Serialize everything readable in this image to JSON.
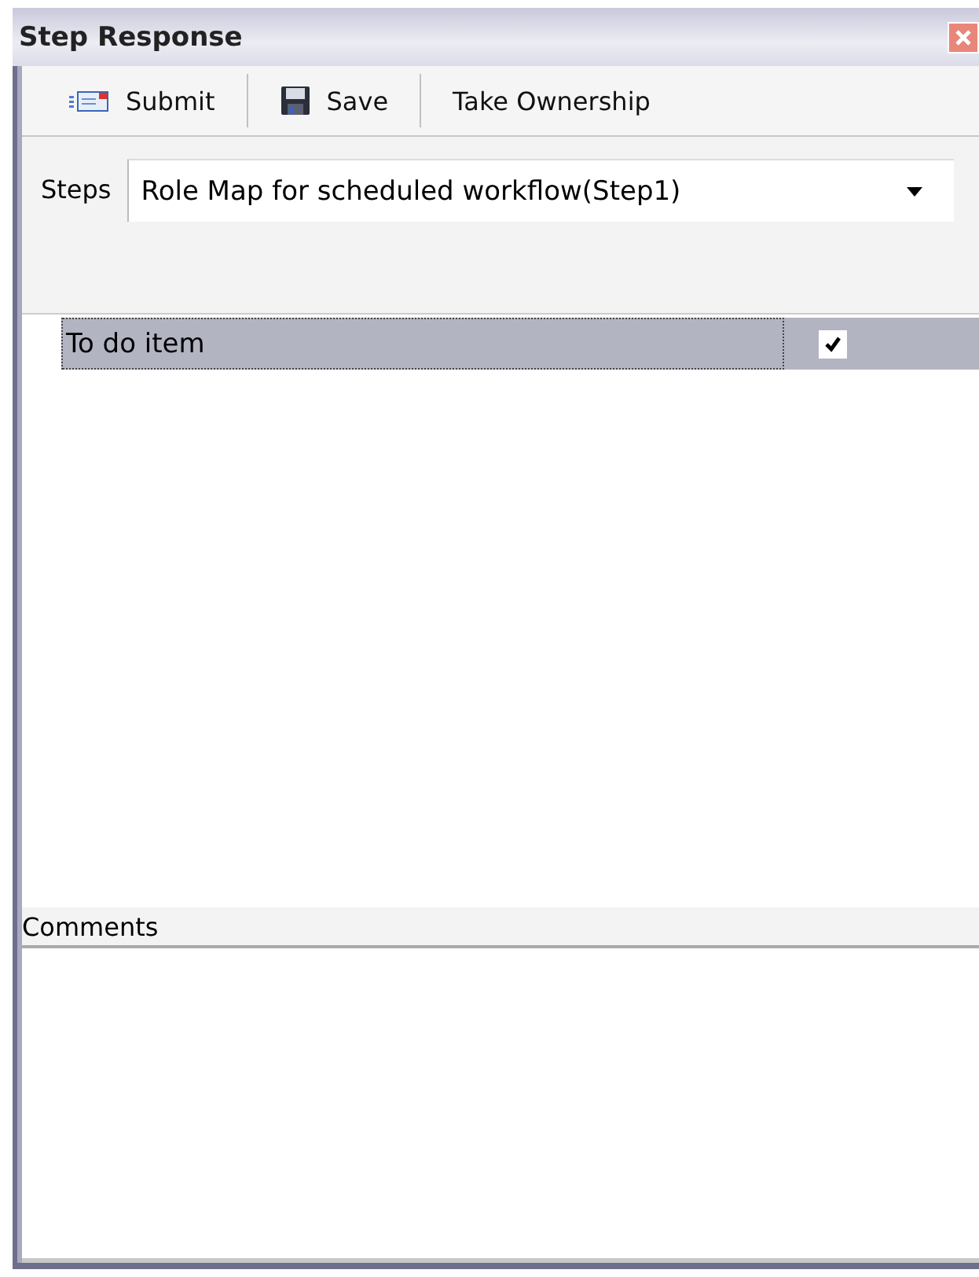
{
  "window": {
    "title": "Step Response"
  },
  "toolbar": [
    {
      "label": "Submit",
      "kind": "send"
    },
    {
      "label": "Save",
      "kind": "save"
    },
    {
      "label": "Take Ownership",
      "kind": "text"
    }
  ],
  "steps": {
    "label": "Steps",
    "value": "Role Map for scheduled workflow(Step1)"
  },
  "items": [
    {
      "label": "To do item",
      "checked": true,
      "selected": true
    }
  ],
  "comments": {
    "label": "Comments"
  }
}
